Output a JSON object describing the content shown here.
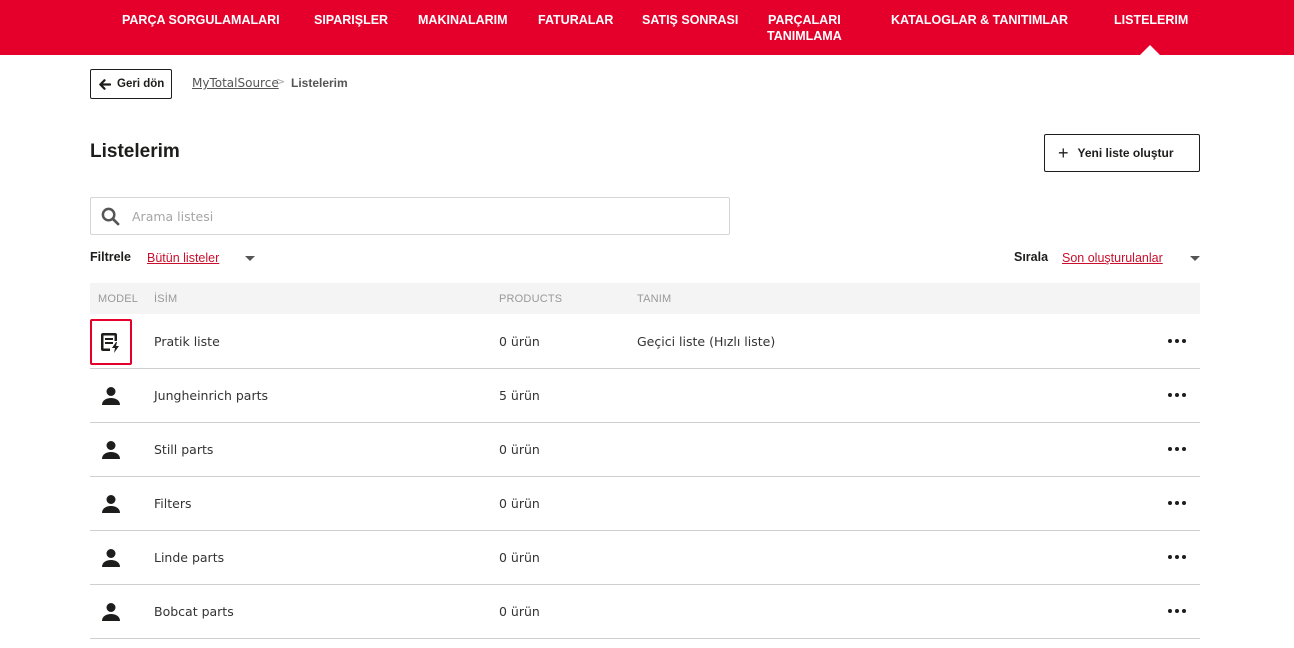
{
  "nav": {
    "items": [
      {
        "label": "PARÇA SORGULAMALARI"
      },
      {
        "label": "SIPARIŞLER"
      },
      {
        "label": "MAKINALARIM"
      },
      {
        "label": "FATURALAR"
      },
      {
        "label": "SATIŞ SONRASI"
      },
      {
        "label": "PARÇALARI",
        "label2": "TANIMLAMA"
      },
      {
        "label": "KATALOGLAR & TANITIMLAR"
      },
      {
        "label": "LISTELERIM",
        "active": true
      }
    ]
  },
  "breadcrumb": {
    "back_label": "Geri dön",
    "root": "MyTotalSource",
    "separator": ">",
    "current": "Listelerim"
  },
  "page": {
    "title": "Listelerim",
    "new_list_label": "Yeni liste oluştur",
    "new_list_icon": "+"
  },
  "search": {
    "placeholder": "Arama listesi",
    "value": ""
  },
  "filter": {
    "label": "Filtrele",
    "value": "Bütün listeler"
  },
  "sort": {
    "label": "Sırala",
    "value": "Son oluşturulanlar"
  },
  "table": {
    "headers": {
      "model": "MODEL",
      "name": "İSİM",
      "products": "PRODUCTS",
      "description": "TANIM"
    },
    "rows": [
      {
        "icon": "quick-list-icon",
        "name": "Pratik liste",
        "products": "0 ürün",
        "description": "Geçici liste (Hızlı liste)",
        "highlighted": true
      },
      {
        "icon": "person-icon",
        "name": "Jungheinrich parts",
        "products": "5 ürün",
        "description": ""
      },
      {
        "icon": "person-icon",
        "name": "Still parts",
        "products": "0 ürün",
        "description": ""
      },
      {
        "icon": "person-icon",
        "name": "Filters",
        "products": "0 ürün",
        "description": ""
      },
      {
        "icon": "person-icon",
        "name": "Linde parts",
        "products": "0 ürün",
        "description": ""
      },
      {
        "icon": "person-icon",
        "name": "Bobcat parts",
        "products": "0 ürün",
        "description": ""
      }
    ]
  },
  "colors": {
    "brand": "#e4002b",
    "link": "#c8102e",
    "text": "#1d1d1b"
  }
}
